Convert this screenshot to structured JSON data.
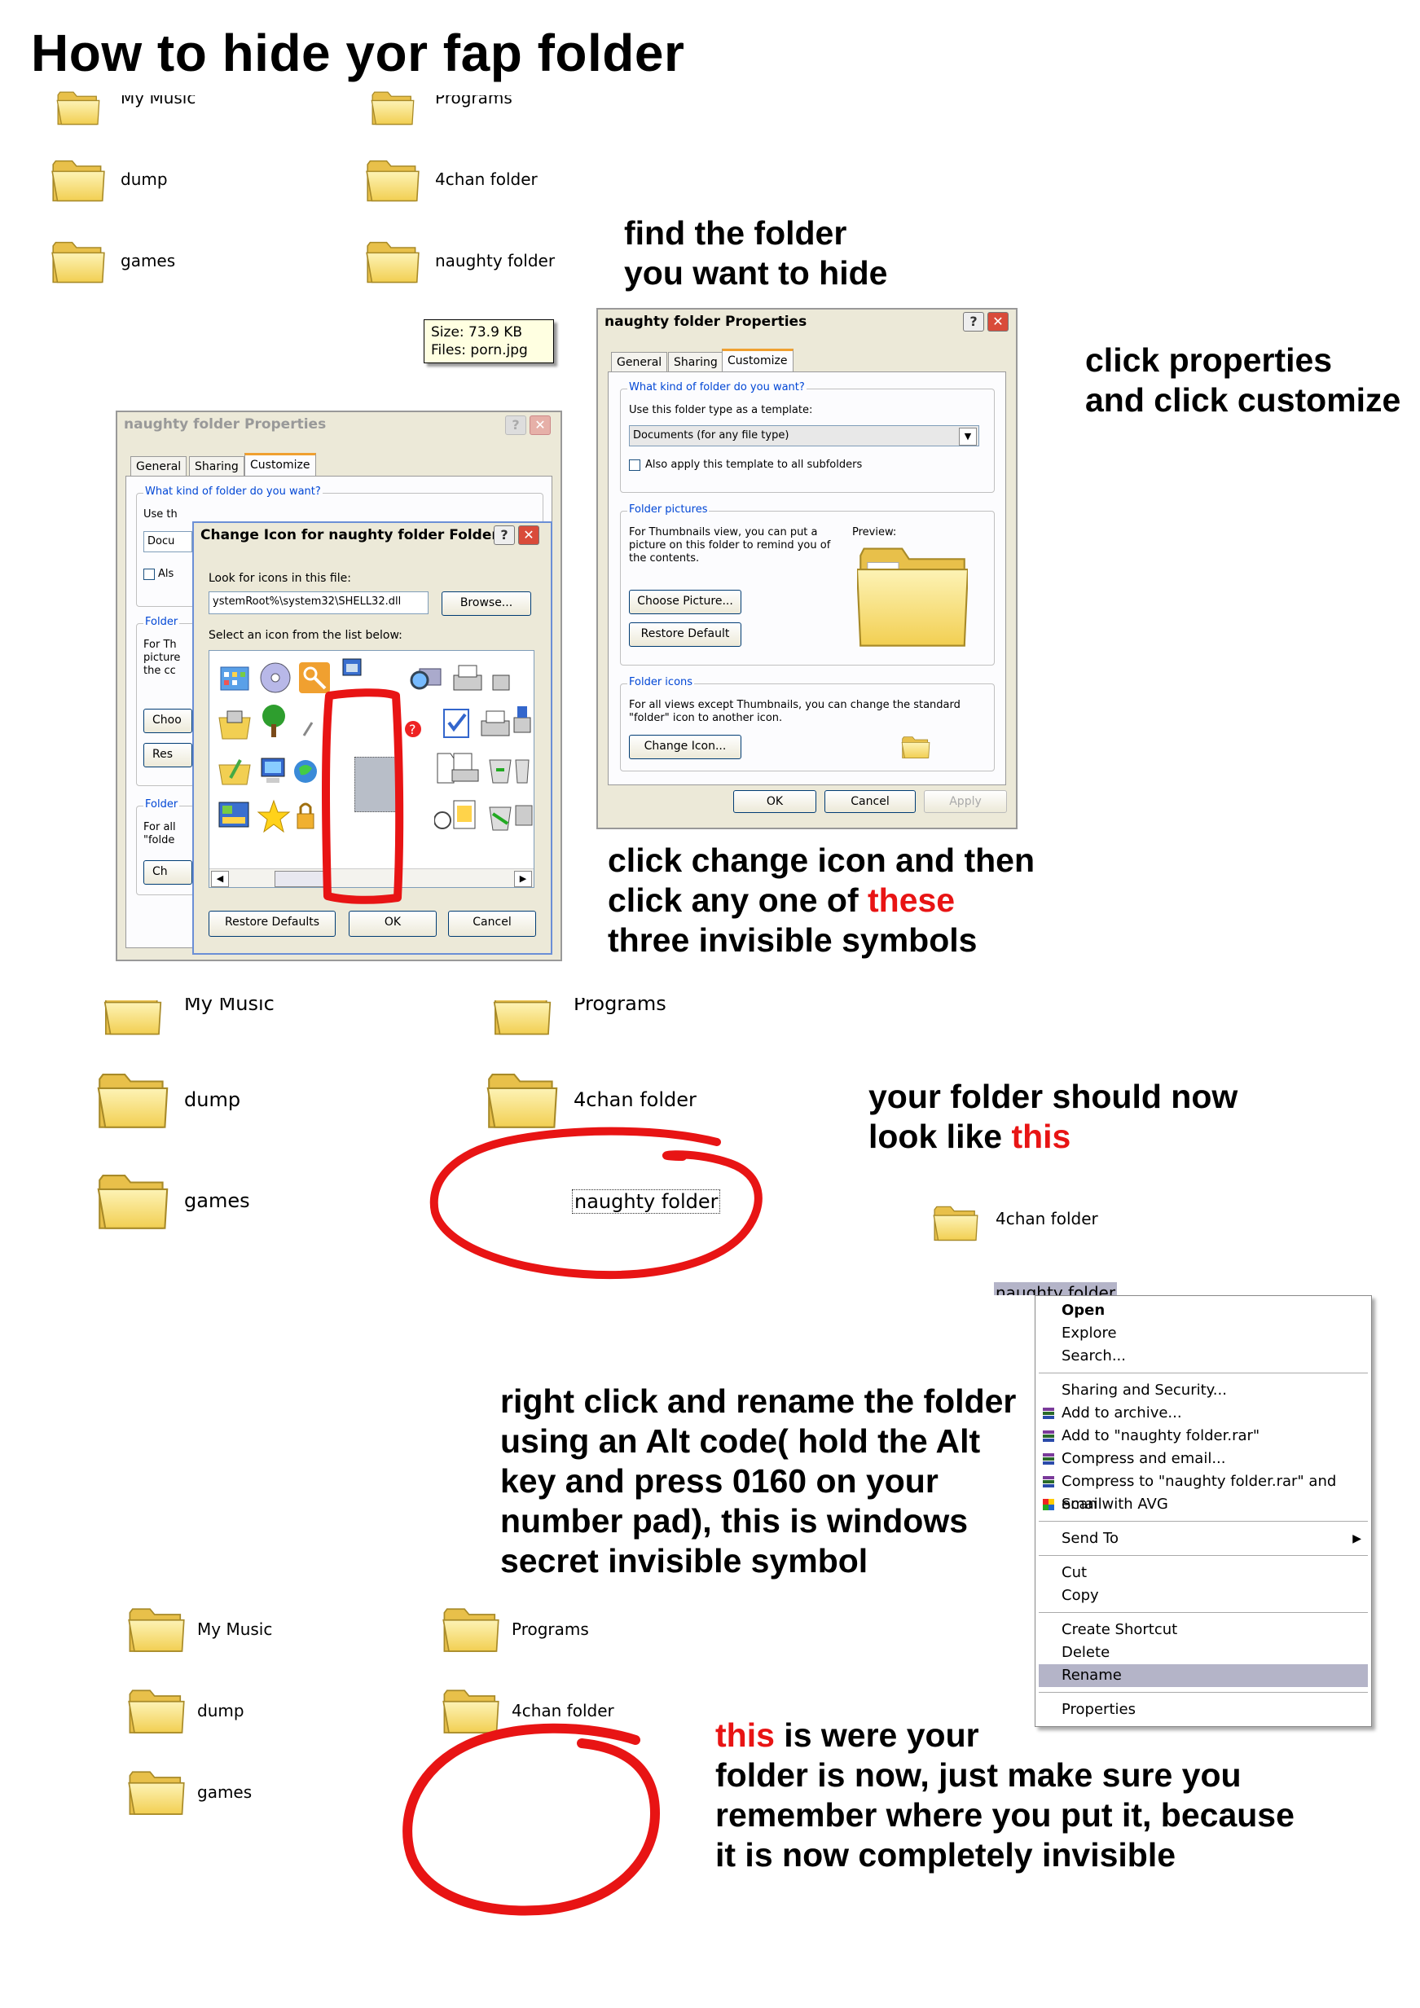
{
  "title": "How to hide yor fap folder",
  "steps": {
    "step1": [
      "find the folder",
      "you want to hide"
    ],
    "step2": [
      "click properties",
      "and click customize"
    ],
    "step3": {
      "line1": "click change icon and then",
      "line2_a": "click any one of ",
      "line2_red": "these",
      "line3": "three invisible symbols"
    },
    "step4": {
      "line1": "your folder should now",
      "line2_a": "look like ",
      "line2_red": "this"
    },
    "step5": [
      "right click and rename the folder",
      "using an Alt code( hold the Alt",
      "key and press 0160 on your",
      "number pad), this is windows",
      "secret invisible symbol"
    ],
    "step6": {
      "line1_red": "this",
      "line1_b": " is were your",
      "line2": "folder is now, just make sure you",
      "line3": "remember where you put it, because",
      "line4": "it is now completely invisible"
    }
  },
  "explorer1": {
    "folders": [
      "My Music",
      "Programs",
      "dump",
      "4chan folder",
      "games",
      "naughty folder"
    ],
    "tooltip": [
      "Size: 73.9 KB",
      "Files: porn.jpg"
    ]
  },
  "props_dialog": {
    "title": "naughty folder Properties",
    "tabs": [
      "General",
      "Sharing",
      "Customize"
    ],
    "group1_title": "What kind of folder do you want?",
    "template_label": "Use this folder type as a template:",
    "template_value": "Documents (for any file type)",
    "also_apply": "Also apply this template to all subfolders",
    "group2_title": "Folder pictures",
    "pictures_text": [
      "For Thumbnails view, you can put a",
      "picture on this folder to remind you of",
      "the contents."
    ],
    "preview_label": "Preview:",
    "choose_picture": "Choose Picture...",
    "restore_default": "Restore Default",
    "group3_title": "Folder icons",
    "icons_text": [
      "For all views except Thumbnails, you can change the standard",
      "\"folder\" icon to another icon."
    ],
    "change_icon": "Change Icon...",
    "ok": "OK",
    "cancel": "Cancel",
    "apply": "Apply"
  },
  "change_icon_dialog": {
    "bg_title": "naughty folder Properties",
    "bg_tabs": [
      "General",
      "Sharing",
      "Customize"
    ],
    "bg_group1": "What kind of folder do you want?",
    "bg_use": "Use th",
    "bg_docu": "Docu",
    "bg_als": "Als",
    "bg_folder": "Folder",
    "bg_forth": "For Th",
    "bg_picture": "picture",
    "bg_thecc": "the cc",
    "bg_cho": "Choo",
    "bg_res": "Res",
    "bg_folder2": "Folder",
    "bg_forall": "For all",
    "bg_folde": "\"folde",
    "bg_ch": "Ch",
    "title": "Change Icon for naughty folder Folder",
    "look_label": "Look for icons in this file:",
    "path": "ystemRoot%\\system32\\SHELL32.dll",
    "browse": "Browse...",
    "select_label": "Select an icon from the list below:",
    "restore_defaults": "Restore Defaults",
    "ok": "OK",
    "cancel": "Cancel"
  },
  "explorer2": {
    "folders": [
      "My Music",
      "Programs",
      "dump",
      "4chan folder",
      "games"
    ],
    "renamed": "naughty folder"
  },
  "explorer3": {
    "folder": "4chan folder",
    "renamed": "naughty folder"
  },
  "context_menu": {
    "items": [
      "Open",
      "Explore",
      "Search...",
      "Sharing and Security...",
      "Add to archive...",
      "Add to \"naughty folder.rar\"",
      "Compress and email...",
      "Compress to \"naughty folder.rar\" and email",
      "Scan with AVG",
      "Send To",
      "Cut",
      "Copy",
      "Create Shortcut",
      "Delete",
      "Rename",
      "Properties"
    ]
  },
  "explorer4": {
    "folders": [
      "My Music",
      "Programs",
      "dump",
      "4chan folder",
      "games"
    ]
  },
  "colors": {
    "annotation_red": "#e81414",
    "folder_yellow": "#f6d565",
    "xp_blue": "#0046d5"
  }
}
